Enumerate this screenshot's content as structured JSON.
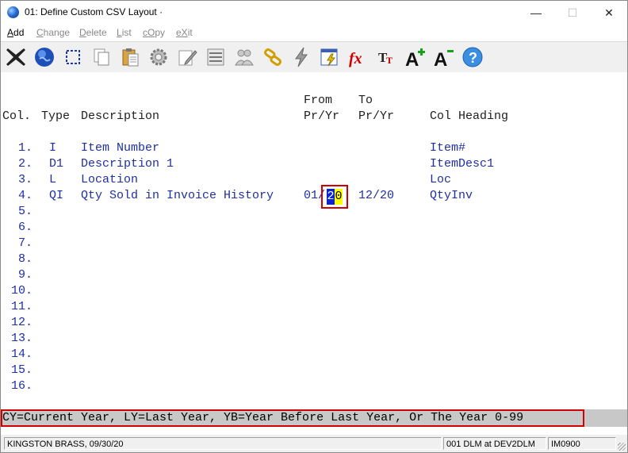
{
  "window": {
    "title": "01: Define Custom CSV Layout ·",
    "controls": {
      "minimize": "—",
      "maximize": "☐",
      "close": "✕"
    }
  },
  "menu": [
    {
      "label": "Add",
      "mnemonic": "A",
      "rest": "dd",
      "enabled": true
    },
    {
      "label": "Change",
      "mnemonic": "C",
      "rest": "hange",
      "enabled": false
    },
    {
      "label": "Delete",
      "mnemonic": "D",
      "rest": "elete",
      "enabled": false
    },
    {
      "label": "List",
      "mnemonic": "L",
      "rest": "ist",
      "enabled": false
    },
    {
      "label": "cOpy",
      "mnemonic": "cO",
      "rest": "py",
      "enabled": false
    },
    {
      "label": "eXit",
      "mnemonic": "eX",
      "rest": "it",
      "enabled": false
    }
  ],
  "toolbar": [
    {
      "name": "exit-icon"
    },
    {
      "name": "globe-icon"
    },
    {
      "name": "select-icon"
    },
    {
      "name": "copy-icon"
    },
    {
      "name": "paste-icon"
    },
    {
      "name": "settings-icon"
    },
    {
      "name": "edit-icon"
    },
    {
      "name": "list-icon"
    },
    {
      "name": "users-icon"
    },
    {
      "name": "link-icon"
    },
    {
      "name": "lightning-icon"
    },
    {
      "name": "run-report-icon"
    },
    {
      "name": "function-icon"
    },
    {
      "name": "font-size-icon"
    },
    {
      "name": "font-larger-icon"
    },
    {
      "name": "font-smaller-icon"
    },
    {
      "name": "help-icon"
    }
  ],
  "headers": {
    "col": "Col.",
    "type": "Type",
    "description": "Description",
    "from_top": "From",
    "from_bottom": "Pr/Yr",
    "to_top": "To",
    "to_bottom": "Pr/Yr",
    "col_heading": "Col Heading"
  },
  "rows": [
    {
      "num": "1.",
      "type": "I",
      "description": "Item Number",
      "from": "",
      "to": "",
      "heading": "Item#"
    },
    {
      "num": "2.",
      "type": "D1",
      "description": "Description 1",
      "from": "",
      "to": "",
      "heading": "ItemDesc1"
    },
    {
      "num": "3.",
      "type": "L",
      "description": "Location",
      "from": "",
      "to": "",
      "heading": "Loc"
    },
    {
      "num": "4.",
      "type": "QI",
      "description": "Qty Sold in Invoice History",
      "from": "01/",
      "to": "12/20",
      "heading": "QtyInv"
    },
    {
      "num": "5.",
      "type": "",
      "description": "",
      "from": "",
      "to": "",
      "heading": ""
    },
    {
      "num": "6.",
      "type": "",
      "description": "",
      "from": "",
      "to": "",
      "heading": ""
    },
    {
      "num": "7.",
      "type": "",
      "description": "",
      "from": "",
      "to": "",
      "heading": ""
    },
    {
      "num": "8.",
      "type": "",
      "description": "",
      "from": "",
      "to": "",
      "heading": ""
    },
    {
      "num": "9.",
      "type": "",
      "description": "",
      "from": "",
      "to": "",
      "heading": ""
    },
    {
      "num": "10.",
      "type": "",
      "description": "",
      "from": "",
      "to": "",
      "heading": ""
    },
    {
      "num": "11.",
      "type": "",
      "description": "",
      "from": "",
      "to": "",
      "heading": ""
    },
    {
      "num": "12.",
      "type": "",
      "description": "",
      "from": "",
      "to": "",
      "heading": ""
    },
    {
      "num": "13.",
      "type": "",
      "description": "",
      "from": "",
      "to": "",
      "heading": ""
    },
    {
      "num": "14.",
      "type": "",
      "description": "",
      "from": "",
      "to": "",
      "heading": ""
    },
    {
      "num": "15.",
      "type": "",
      "description": "",
      "from": "",
      "to": "",
      "heading": ""
    },
    {
      "num": "16.",
      "type": "",
      "description": "",
      "from": "",
      "to": "",
      "heading": ""
    }
  ],
  "editing": {
    "char1": "2",
    "char2": "0"
  },
  "help_line": "CY=Current Year, LY=Last Year, YB=Year Before Last Year, Or The Year 0-99",
  "status": {
    "company": "KINGSTON BRASS, 09/30/20",
    "session": "001 DLM at DEV2DLM",
    "program": "IM0900"
  },
  "colors": {
    "text_blue": "#1e2fa0",
    "highlight_red": "#d00000",
    "cursor_blue": "#0a24d0",
    "cursor_yellow": "#ffff00"
  }
}
